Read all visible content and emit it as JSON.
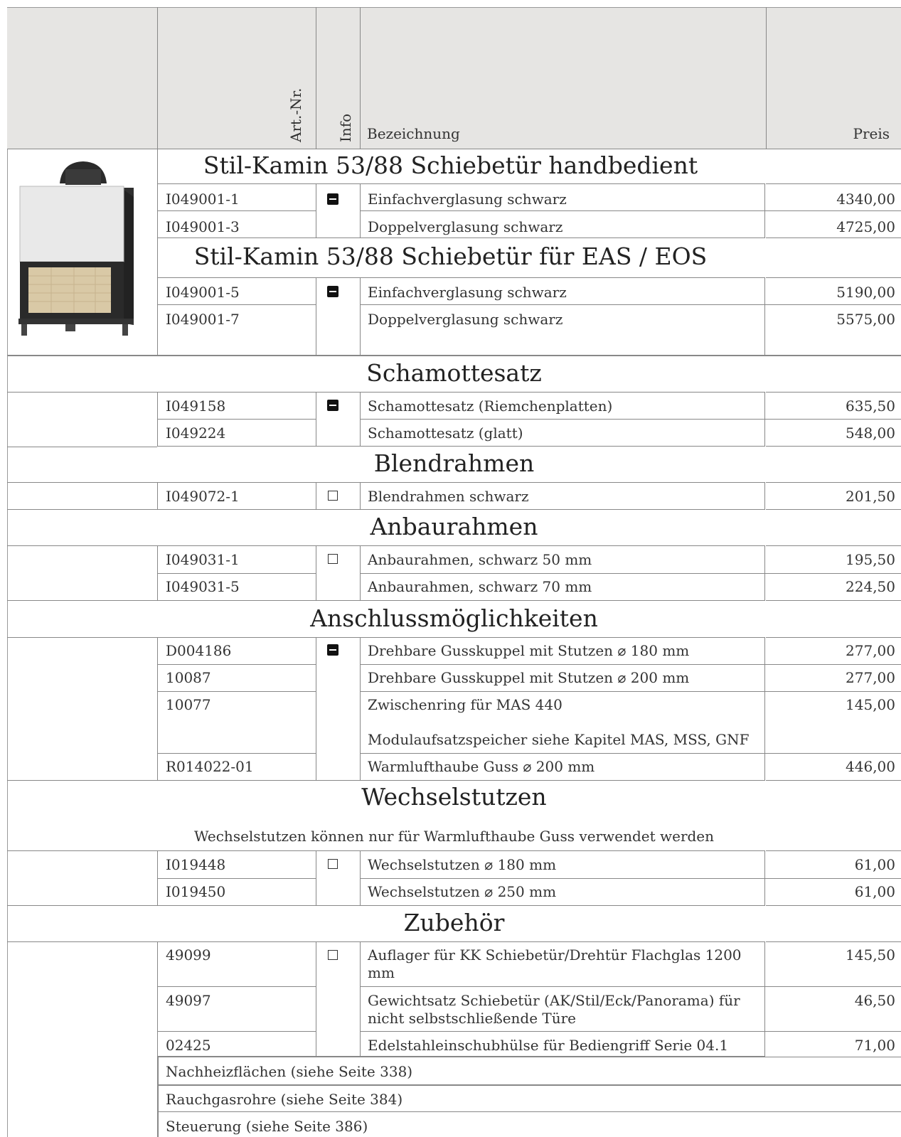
{
  "header": {
    "artnr": "Art.-Nr.",
    "info": "Info",
    "bezeichnung": "Bezeichnung",
    "preis": "Preis"
  },
  "sections": {
    "s1": "Stil-Kamin 53/88 Schiebetür handbedient",
    "s2": "Stil-Kamin 53/88 Schiebetür für EAS / EOS",
    "s3": "Schamottesatz",
    "s4": "Blendrahmen",
    "s5": "Anbaurahmen",
    "s6": "Anschlussmöglichkeiten",
    "s7": "Wechselstutzen",
    "s7note": "Wechselstutzen können nur für Warmlufthaube Guss verwendet werden",
    "s8": "Zubehör"
  },
  "rows": {
    "r1": {
      "art": "I049001-1",
      "desc": "Einfachverglasung schwarz",
      "price": "4340,00"
    },
    "r2": {
      "art": "I049001-3",
      "desc": "Doppelverglasung schwarz",
      "price": "4725,00"
    },
    "r3": {
      "art": "I049001-5",
      "desc": "Einfachverglasung schwarz",
      "price": "5190,00"
    },
    "r4": {
      "art": "I049001-7",
      "desc": "Doppelverglasung schwarz",
      "price": "5575,00"
    },
    "r5": {
      "art": "I049158",
      "desc": "Schamottesatz (Riemchenplatten)",
      "price": "635,50"
    },
    "r6": {
      "art": "I049224",
      "desc": "Schamottesatz (glatt)",
      "price": "548,00"
    },
    "r7": {
      "art": "I049072-1",
      "desc": "Blendrahmen schwarz",
      "price": "201,50"
    },
    "r8": {
      "art": "I049031-1",
      "desc": "Anbaurahmen, schwarz 50 mm",
      "price": "195,50"
    },
    "r9": {
      "art": "I049031-5",
      "desc": "Anbaurahmen, schwarz 70 mm",
      "price": "224,50"
    },
    "r10": {
      "art": "D004186",
      "desc": "Drehbare Gusskuppel mit Stutzen ⌀ 180 mm",
      "price": "277,00"
    },
    "r11": {
      "art": "10087",
      "desc": "Drehbare Gusskuppel mit Stutzen ⌀ 200 mm",
      "price": "277,00"
    },
    "r12": {
      "art": "10077",
      "desc": "Zwischenring für MAS 440",
      "desc2": "Modulaufsatzspeicher siehe Kapitel MAS, MSS, GNF",
      "price": "145,00"
    },
    "r13": {
      "art": "R014022-01",
      "desc": "Warmlufthaube Guss ⌀ 200 mm",
      "price": "446,00"
    },
    "r14": {
      "art": "I019448",
      "desc": "Wechselstutzen ⌀ 180 mm",
      "price": "61,00"
    },
    "r15": {
      "art": "I019450",
      "desc": "Wechselstutzen ⌀ 250 mm",
      "price": "61,00"
    },
    "r16": {
      "art": "49099",
      "desc": "Auflager für KK Schiebetür/Drehtür Flachglas 1200",
      "desc2": "mm",
      "price": "145,50"
    },
    "r17": {
      "art": "49097",
      "desc": "Gewichtsatz Schiebetür (AK/Stil/Eck/Panorama) für",
      "desc2": "nicht selbstschließende Türe",
      "price": "46,50"
    },
    "r18": {
      "art": "02425",
      "desc": "Edelstahleinschubhülse für Bediengriff Serie 04.1",
      "price": "71,00"
    }
  },
  "refs": {
    "ref1": "Nachheizflächen (siehe Seite 338)",
    "ref2": "Rauchgasrohre (siehe Seite 384)",
    "ref3": "Steuerung (siehe Seite 386)"
  },
  "info_icons": {
    "filled": "minus-box-icon",
    "empty": "empty-checkbox-icon"
  }
}
